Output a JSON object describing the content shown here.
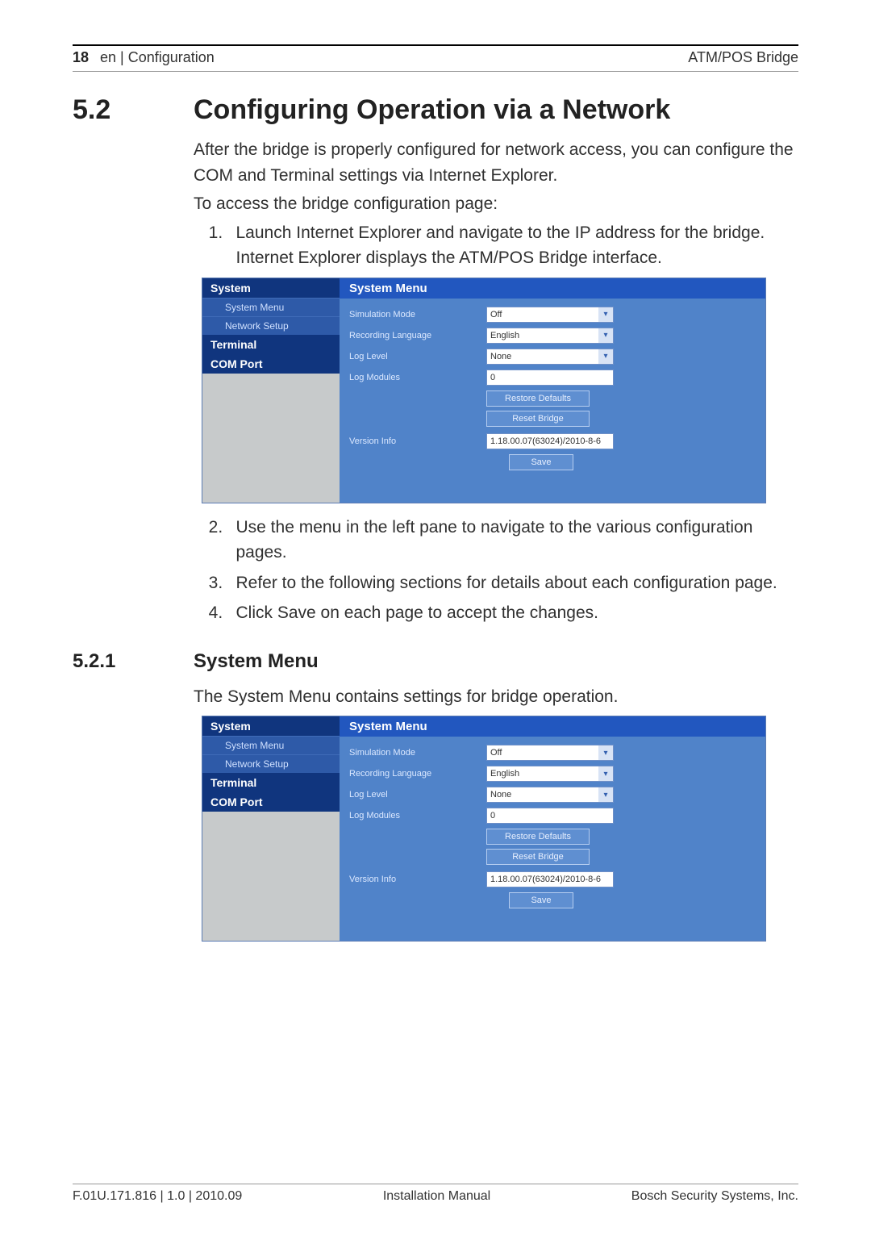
{
  "header": {
    "page_number": "18",
    "breadcrumb": "en | Configuration",
    "product": "ATM/POS Bridge"
  },
  "section": {
    "number": "5.2",
    "title": "Configuring Operation via a Network",
    "intro1": "After the bridge is properly configured for network access, you can configure the COM and Terminal settings via Internet Explorer.",
    "intro2": "To access the bridge configuration page:",
    "steps": [
      "Launch Internet Explorer and navigate to the IP address for the bridge.",
      "Use the menu in the left pane to navigate to the various configuration pages.",
      "Refer to the following sections for details about each configuration page.",
      "Click Save on each page to accept the changes."
    ],
    "step1_note": "Internet Explorer displays the ATM/POS Bridge interface."
  },
  "subsection": {
    "number": "5.2.1",
    "title": "System Menu",
    "desc": "The System Menu contains settings for bridge operation."
  },
  "screenshot": {
    "sidebar": {
      "header": "System",
      "items": [
        "System Menu",
        "Network Setup",
        "Terminal",
        "COM Port"
      ]
    },
    "main": {
      "title": "System Menu",
      "fields": {
        "simulation_mode": {
          "label": "Simulation Mode",
          "value": "Off"
        },
        "recording_language": {
          "label": "Recording Language",
          "value": "English"
        },
        "log_level": {
          "label": "Log Level",
          "value": "None"
        },
        "log_modules": {
          "label": "Log Modules",
          "value": "0"
        },
        "version_info": {
          "label": "Version Info",
          "value": "1.18.00.07(63024)/2010-8-6"
        }
      },
      "buttons": {
        "restore": "Restore Defaults",
        "reset": "Reset Bridge",
        "save": "Save"
      }
    }
  },
  "footer": {
    "left": "F.01U.171.816 | 1.0 | 2010.09",
    "center": "Installation Manual",
    "right": "Bosch Security Systems, Inc."
  }
}
